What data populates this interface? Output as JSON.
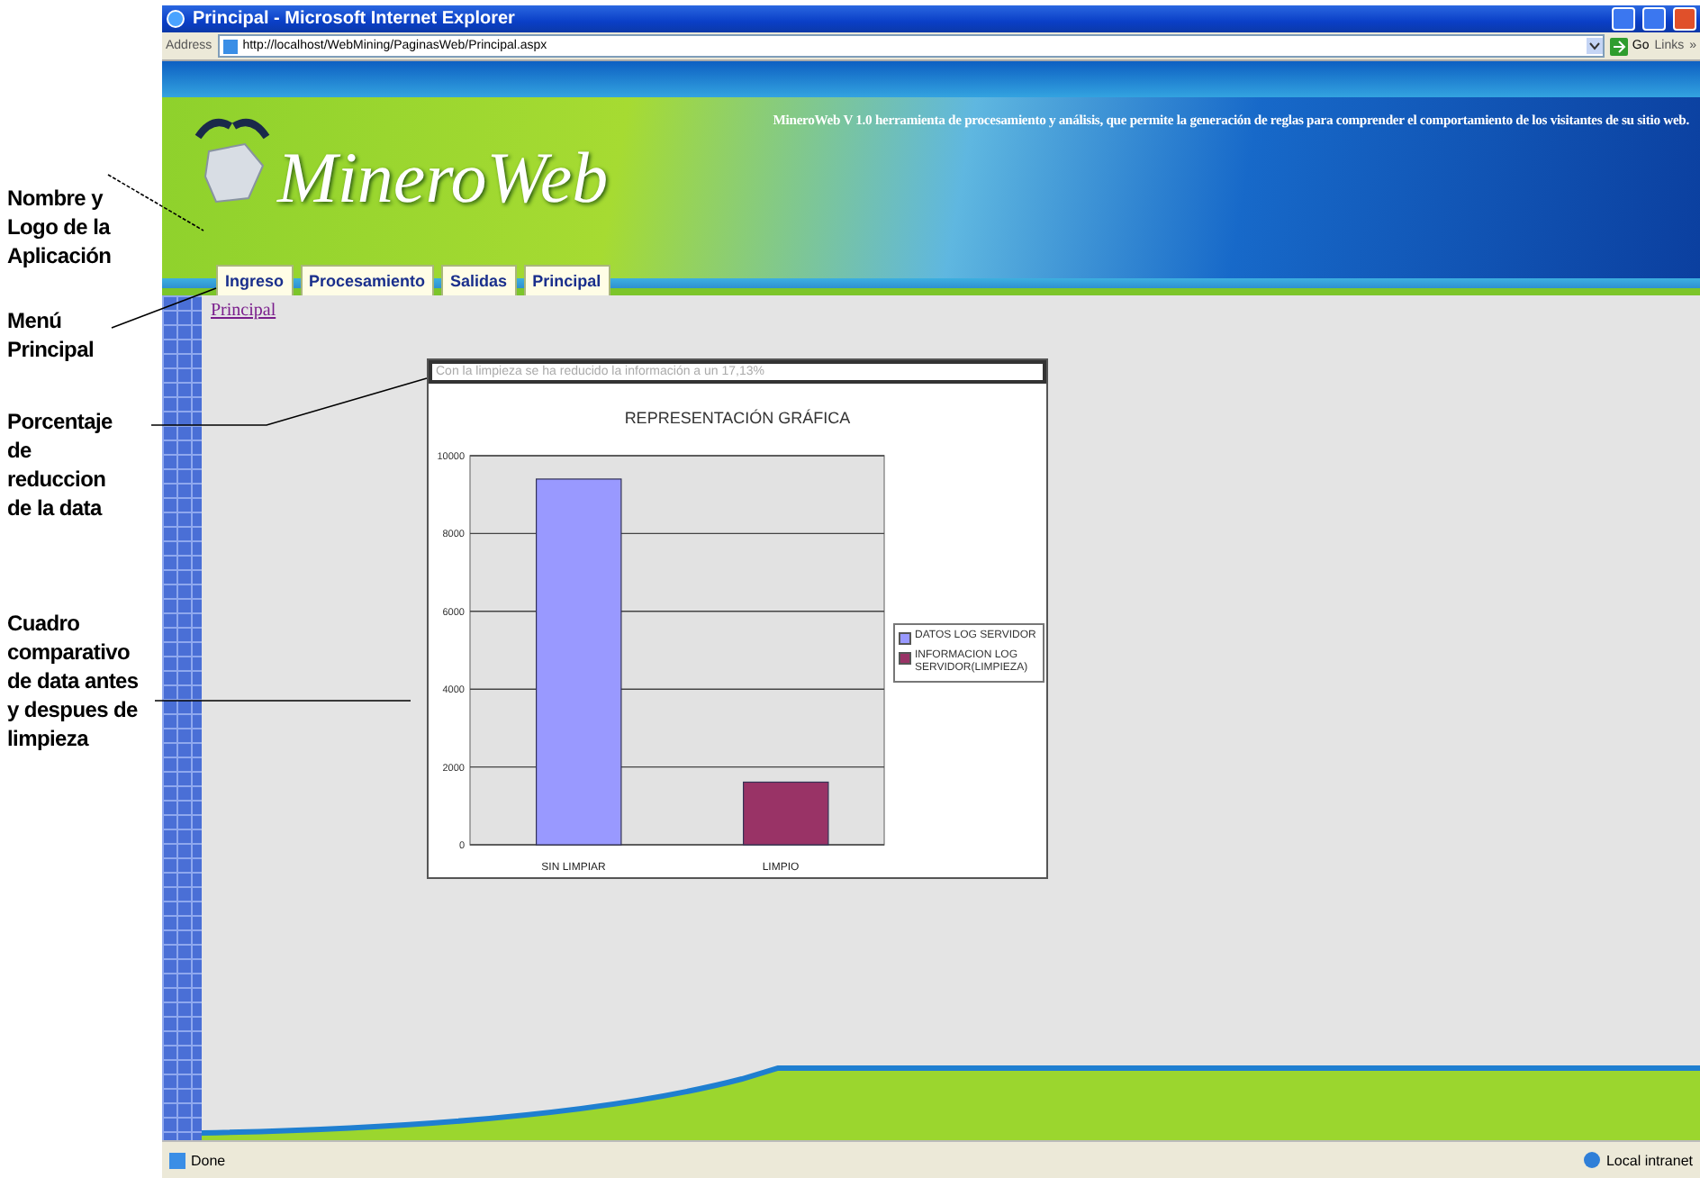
{
  "annotations": [
    {
      "text": "Nombre y Logo de la Aplicación"
    },
    {
      "text": "Menú Principal"
    },
    {
      "text": "Porcentaje de reduccion de la data"
    },
    {
      "text": "Cuadro comparativo de data antes y despues de limpieza"
    }
  ],
  "window": {
    "title": "Principal - Microsoft Internet Explorer"
  },
  "address_bar": {
    "label": "Address",
    "url": "http://localhost/WebMining/PaginasWeb/Principal.aspx",
    "go": "Go",
    "links": "Links",
    "chevron": "»"
  },
  "header": {
    "logo": "MineroWeb",
    "tagline": "MineroWeb V 1.0 herramienta de procesamiento y análisis, que permite la generación de reglas para comprender el comportamiento de los visitantes de su sitio web."
  },
  "menu": [
    {
      "label": "Ingreso"
    },
    {
      "label": "Procesamiento"
    },
    {
      "label": "Salidas"
    },
    {
      "label": "Principal"
    }
  ],
  "breadcrumb": "Principal",
  "reduction_note": "Con la limpieza se ha reducido  la información a un 17,13%",
  "chart": {
    "chart_data": {
      "type": "bar",
      "title": "REPRESENTACIÓN GRÁFICA",
      "categories": [
        "SIN LIMPIAR",
        "LIMPIO"
      ],
      "ylim": [
        0,
        10000
      ],
      "grid": true,
      "legend": true,
      "yticks": [
        0,
        2000,
        4000,
        6000,
        8000,
        10000
      ],
      "series": [
        {
          "name": "DATOS LOG SERVIDOR",
          "color": "#9999ff",
          "values": [
            9400,
            null
          ]
        },
        {
          "name": "INFORMACION LOG SERVIDOR(LIMPIEZA)",
          "color": "#993366",
          "values": [
            null,
            1610
          ]
        }
      ]
    }
  },
  "status_bar": {
    "status": "Done",
    "zone": "Local intranet"
  }
}
